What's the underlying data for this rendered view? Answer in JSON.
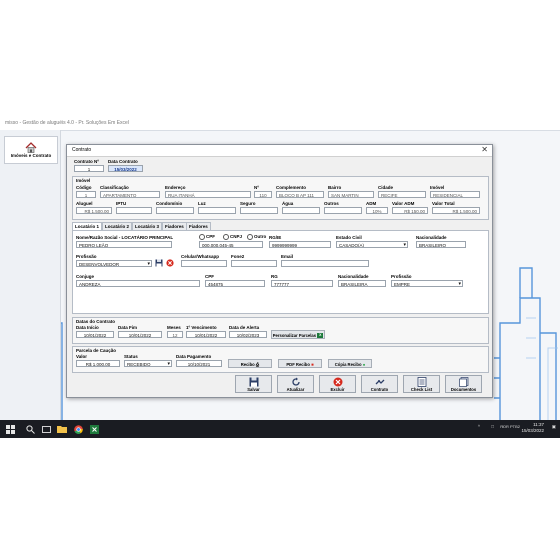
{
  "app": {
    "title": "misso - Gestão de aluguéis 4.0 - Pr. Soluções Em Excel"
  },
  "sidebar": {
    "home_label": "Imóveis e Contrato"
  },
  "window": {
    "title": "Contrato",
    "close": "✕"
  },
  "contract": {
    "num_label": "Contrato Nº",
    "num_value": "1",
    "date_label": "Data Contrato",
    "date_value": "15/03/2022"
  },
  "imovel": {
    "section": "Imóvel",
    "labels": {
      "codigo": "Código",
      "classificacao": "Classificação",
      "endereco": "Endereço",
      "numero": "Nº",
      "complemento": "Complemento",
      "bairro": "Bairro",
      "cidade": "Cidade",
      "imovel": "Imóvel",
      "aluguel": "Aluguel",
      "iptu": "IPTU",
      "condominio": "Condomínio",
      "luz": "Luz",
      "seguro": "Seguro",
      "agua": "Água",
      "outros": "Outros",
      "adm": "ADM",
      "valor_adm": "Valor ADM",
      "valor_total": "Valor Total"
    },
    "values": {
      "codigo": "1",
      "classificacao": "APARTAMENTO",
      "endereco": "RUA ITANHÁ",
      "numero": "110",
      "complemento": "BLOCO B AP 111",
      "bairro": "SAN MARTIN",
      "cidade": "RECIFE",
      "imovel": "RESIDENCIAL",
      "aluguel": "R$ 1.500,00",
      "iptu": "",
      "condominio": "",
      "luz": "",
      "seguro": "",
      "agua": "",
      "outros": "",
      "adm": "10%",
      "valor_adm": "R$ 150,00",
      "valor_total": "R$ 1.500,00"
    }
  },
  "tabs": [
    "Locatário 1",
    "Locatário 2",
    "Locatário 3",
    "Fiadores",
    "Fiadores"
  ],
  "locatario": {
    "labels": {
      "nome": "Nome/Razão Social - LOCATÁRIO PRINCIPAL",
      "doc": "RG/IE",
      "estado_civil": "Estado Civil",
      "nacionalidade": "Nacionalidade",
      "profissao": "Profissão",
      "celular": "Celular/Whatsapp",
      "fone2": "Fone2",
      "email": "Email",
      "conjuge": "Conjuge",
      "cpf": "CPF",
      "rg": "RG",
      "nacionalidade2": "Nacionalidade",
      "profissao2": "Profissão"
    },
    "radios": [
      "CPF",
      "CNPJ",
      "Outro"
    ],
    "values": {
      "nome": "PEDRO LEÃO",
      "cpf_cnpj": "000.000.045-45",
      "doc": "9999999999",
      "estado_civil": "CASADO(A)",
      "nacionalidade": "BRASILEIRO",
      "profissao": "DESENVOLVEDOR",
      "celular": "",
      "fone2": "",
      "email": "",
      "conjuge": "ANDREZA",
      "cpf": "454875",
      "rg": "777777",
      "nacionalidade2": "BRASILEIRA",
      "profissao2": "EMPRE"
    }
  },
  "datas": {
    "section": "Datas do Contrato",
    "labels": {
      "inicio": "Data Início",
      "fim": "Data Fim",
      "meses": "Meses",
      "venc": "1º Vencimento",
      "alerta": "Data de Alerta"
    },
    "values": {
      "inicio": "10/01/2022",
      "fim": "10/01/2022",
      "meses": "12",
      "venc": "10/01/2022",
      "alerta": "10/02/2023"
    },
    "button": "Personalizar Parcelas"
  },
  "caucao": {
    "section": "Parcela de Caução",
    "labels": {
      "valor": "Valor",
      "status": "Status",
      "pagamento": "Data Pagamento"
    },
    "values": {
      "valor": "R$ 1.000,00",
      "status": "RECEBIDO",
      "pagamento": "10/10/2021"
    },
    "buttons": [
      "Recibo",
      "PDF Recibo",
      "Cópia Recibo"
    ]
  },
  "actions": [
    "Salvar",
    "Atualizar",
    "Excluir",
    "Contrato",
    "Check List",
    "Documentos"
  ],
  "taskbar": {
    "lang": "POR PTB2",
    "time": "11:37",
    "date": "15/03/2022"
  },
  "colors": {
    "accent": "#1a3d8f",
    "delete": "#d62a1e",
    "taskbar": "#1a1c22"
  }
}
